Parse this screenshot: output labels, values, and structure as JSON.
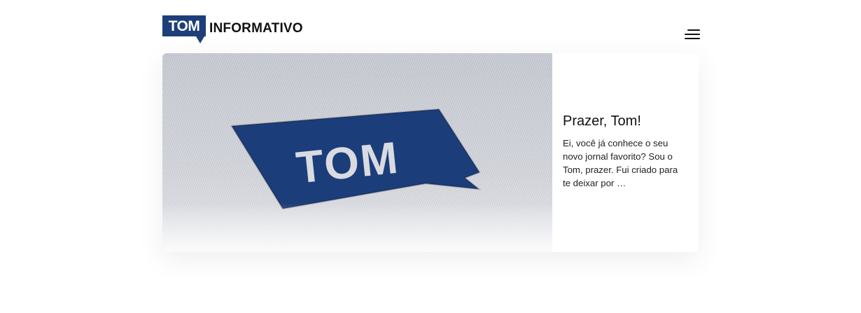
{
  "header": {
    "logo_mark": "TOM",
    "logo_word": "INFORMATIVO",
    "menu_icon": "hamburger-menu-icon"
  },
  "featured_post": {
    "image_logo_text": "TOM",
    "title": "Prazer, Tom!",
    "excerpt": "Ei, você já conhece o seu novo jornal favorito? Sou o Tom, prazer. Fui criado para te deixar por …"
  },
  "colors": {
    "brand_blue": "#1d3e79",
    "text_dark": "#111111",
    "background": "#ffffff"
  }
}
